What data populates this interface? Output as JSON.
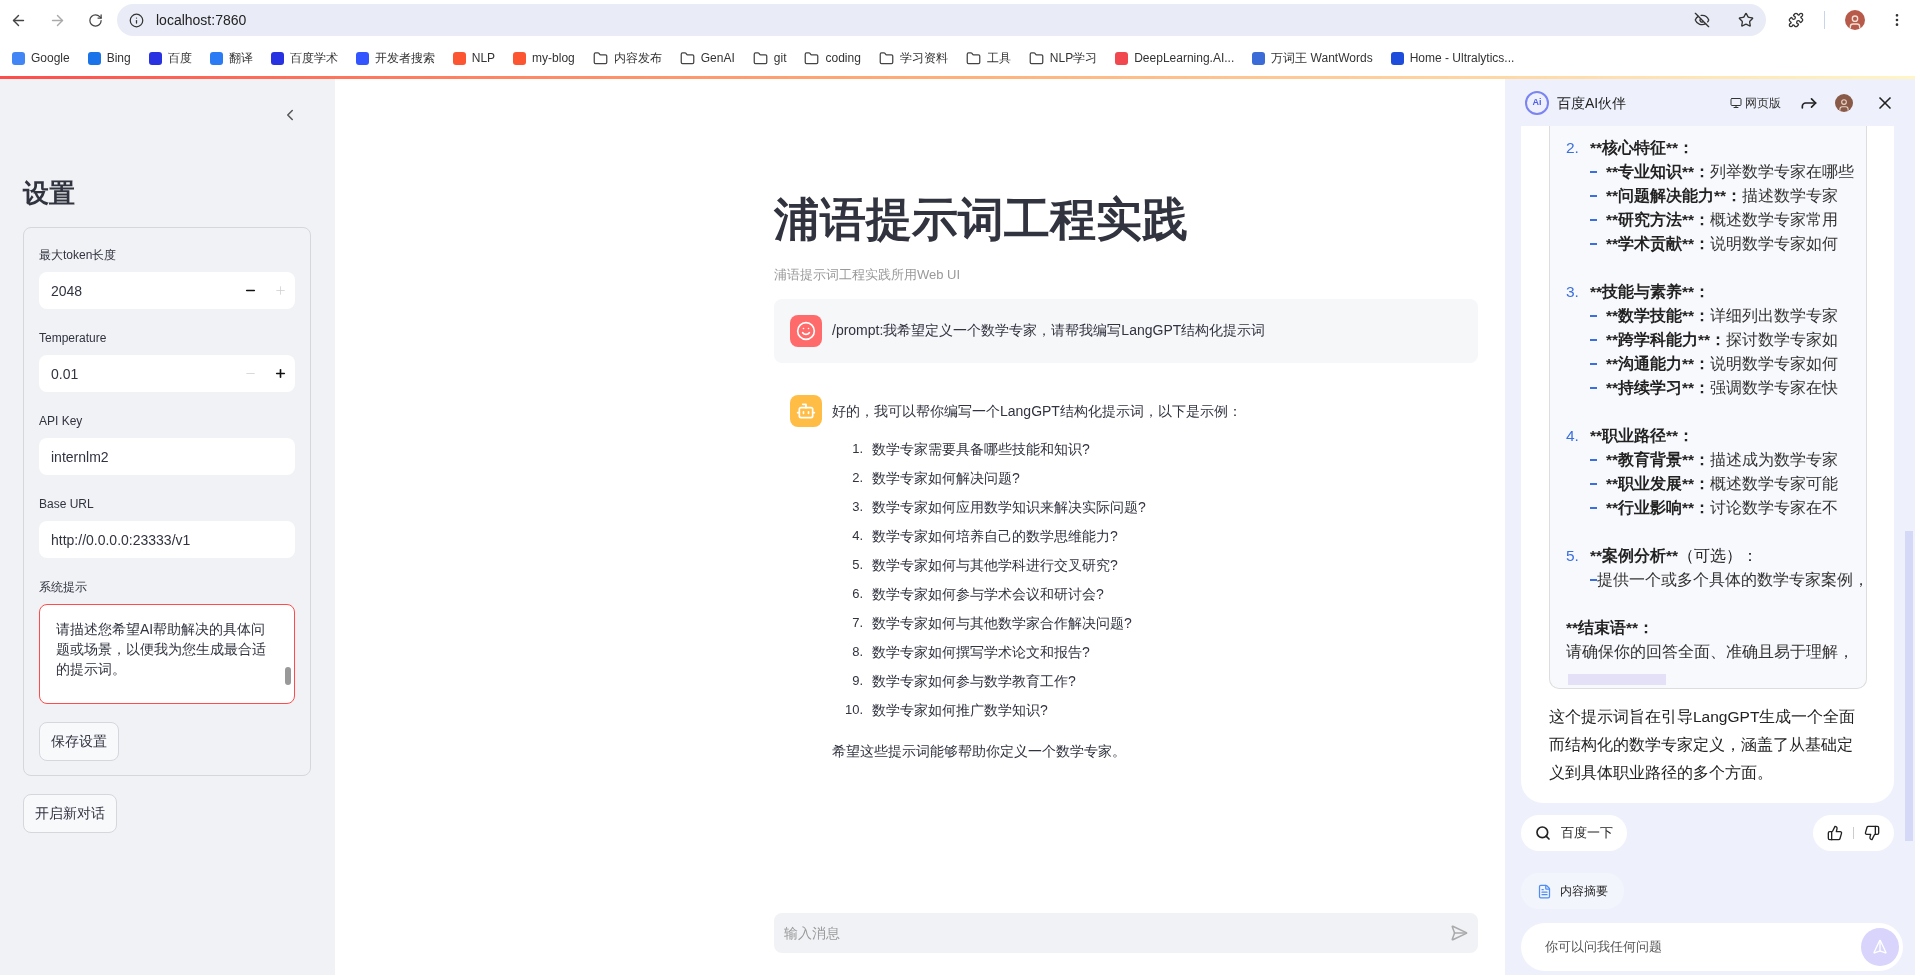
{
  "browser": {
    "url": "localhost:7860",
    "bookmarks": [
      {
        "label": "Google",
        "kind": "site",
        "color": "#4285f4"
      },
      {
        "label": "Bing",
        "kind": "site",
        "color": "#1a73e8"
      },
      {
        "label": "百度",
        "kind": "site",
        "color": "#2932e1"
      },
      {
        "label": "翻译",
        "kind": "site",
        "color": "#2b7bf5"
      },
      {
        "label": "百度学术",
        "kind": "site",
        "color": "#2932e1"
      },
      {
        "label": "开发者搜索",
        "kind": "site",
        "color": "#3355ff"
      },
      {
        "label": "NLP",
        "kind": "site",
        "color": "#fc5531"
      },
      {
        "label": "my-blog",
        "kind": "site",
        "color": "#fc5531"
      },
      {
        "label": "内容发布",
        "kind": "folder"
      },
      {
        "label": "GenAI",
        "kind": "folder"
      },
      {
        "label": "git",
        "kind": "folder"
      },
      {
        "label": "coding",
        "kind": "folder"
      },
      {
        "label": "学习资料",
        "kind": "folder"
      },
      {
        "label": "工具",
        "kind": "folder"
      },
      {
        "label": "NLP学习",
        "kind": "folder"
      },
      {
        "label": "DeepLearning.AI...",
        "kind": "site",
        "color": "#f0484e"
      },
      {
        "label": "万词王 WantWords",
        "kind": "site",
        "color": "#3b6bd6"
      },
      {
        "label": "Home - Ultralytics...",
        "kind": "site",
        "color": "#1f4ddb"
      }
    ]
  },
  "sidebar": {
    "title": "设置",
    "fields": [
      {
        "label": "最大token长度",
        "kind": "number",
        "value": "2048",
        "minus_disabled": false,
        "plus_disabled": true
      },
      {
        "label": "Temperature",
        "kind": "number",
        "value": "0.01",
        "minus_disabled": true,
        "plus_disabled": false
      },
      {
        "label": "API Key",
        "kind": "text",
        "value": "internlm2"
      },
      {
        "label": "Base URL",
        "kind": "text",
        "value": "http://0.0.0.0:23333/v1"
      },
      {
        "label": "系统提示",
        "kind": "textarea",
        "value": "请描述您希望AI帮助解决的具体问题或场景，以便我为您生成最合适的提示词。"
      }
    ],
    "save_button": "保存设置",
    "new_chat_button": "开启新对话"
  },
  "main": {
    "title": "浦语提示词工程实践",
    "subtitle": "浦语提示词工程实践所用Web UI",
    "messages": [
      {
        "kind": "user",
        "text": "/prompt:我希望定义一个数学专家，请帮我编写LangGPT结构化提示词"
      },
      {
        "kind": "assistant",
        "text": "好的，我可以帮你编写一个LangGPT结构化提示词，以下是示例：",
        "list": [
          {
            "number": "1.",
            "text": "数学专家需要具备哪些技能和知识?"
          },
          {
            "number": "2.",
            "text": "数学专家如何解决问题?"
          },
          {
            "number": "3.",
            "text": "数学专家如何应用数学知识来解决实际问题?"
          },
          {
            "number": "4.",
            "text": "数学专家如何培养自己的数学思维能力?"
          },
          {
            "number": "5.",
            "text": "数学专家如何与其他学科进行交叉研究?"
          },
          {
            "number": "6.",
            "text": "数学专家如何参与学术会议和研讨会?"
          },
          {
            "number": "7.",
            "text": "数学专家如何与其他数学家合作解决问题?"
          },
          {
            "number": "8.",
            "text": "数学专家如何撰写学术论文和报告?"
          },
          {
            "number": "9.",
            "text": "数学专家如何参与数学教育工作?"
          },
          {
            "number": "10.",
            "text": "数学专家如何推广数学知识?"
          }
        ],
        "closing": "希望这些提示词能够帮助你定义一个数学专家。"
      }
    ],
    "input_placeholder": "输入消息"
  },
  "assistant_panel": {
    "logo_text": "Ai",
    "title": "百度AI伙伴",
    "web_version": "网页版",
    "code_lines": [
      {
        "kind": "heading",
        "number": "2.",
        "term": "**核心特征**："
      },
      {
        "kind": "item",
        "term": "**专业知识**：",
        "text": "列举数学专家在哪些"
      },
      {
        "kind": "item",
        "term": "**问题解决能力**：",
        "text": "描述数学专家"
      },
      {
        "kind": "item",
        "term": "**研究方法**：",
        "text": "概述数学专家常用"
      },
      {
        "kind": "item",
        "term": "**学术贡献**：",
        "text": "说明数学专家如何"
      },
      {
        "kind": "blank"
      },
      {
        "kind": "heading",
        "number": "3.",
        "term": "**技能与素养**："
      },
      {
        "kind": "item",
        "term": "**数学技能**：",
        "text": "详细列出数学专家"
      },
      {
        "kind": "item",
        "term": "**跨学科能力**：",
        "text": "探讨数学专家如"
      },
      {
        "kind": "item",
        "term": "**沟通能力**：",
        "text": "说明数学专家如何"
      },
      {
        "kind": "item",
        "term": "**持续学习**：",
        "text": "强调数学专家在快"
      },
      {
        "kind": "blank"
      },
      {
        "kind": "heading",
        "number": "4.",
        "term": "**职业路径**："
      },
      {
        "kind": "item",
        "term": "**教育背景**：",
        "text": "描述成为数学专家"
      },
      {
        "kind": "item",
        "term": "**职业发展**：",
        "text": "概述数学专家可能"
      },
      {
        "kind": "item",
        "term": "**行业影响**：",
        "text": "讨论数学专家在不"
      },
      {
        "kind": "blank"
      },
      {
        "kind": "heading",
        "number": "5.",
        "term": "**案例分析**",
        "text": "（可选）："
      },
      {
        "kind": "item",
        "text": "提供一个或多个具体的数学专家案例，"
      },
      {
        "kind": "blank"
      },
      {
        "kind": "bold",
        "text": "**结束语**："
      },
      {
        "kind": "plain",
        "text": "请确保你的回答全面、准确且易于理解，"
      }
    ],
    "summary": "这个提示词旨在引导LangGPT生成一个全面而结构化的数学专家定义，涵盖了从基础定义到具体职业路径的多个方面。",
    "search_button": "百度一下",
    "digest_button": "内容摘要",
    "input_placeholder": "你可以问我任何问题"
  }
}
